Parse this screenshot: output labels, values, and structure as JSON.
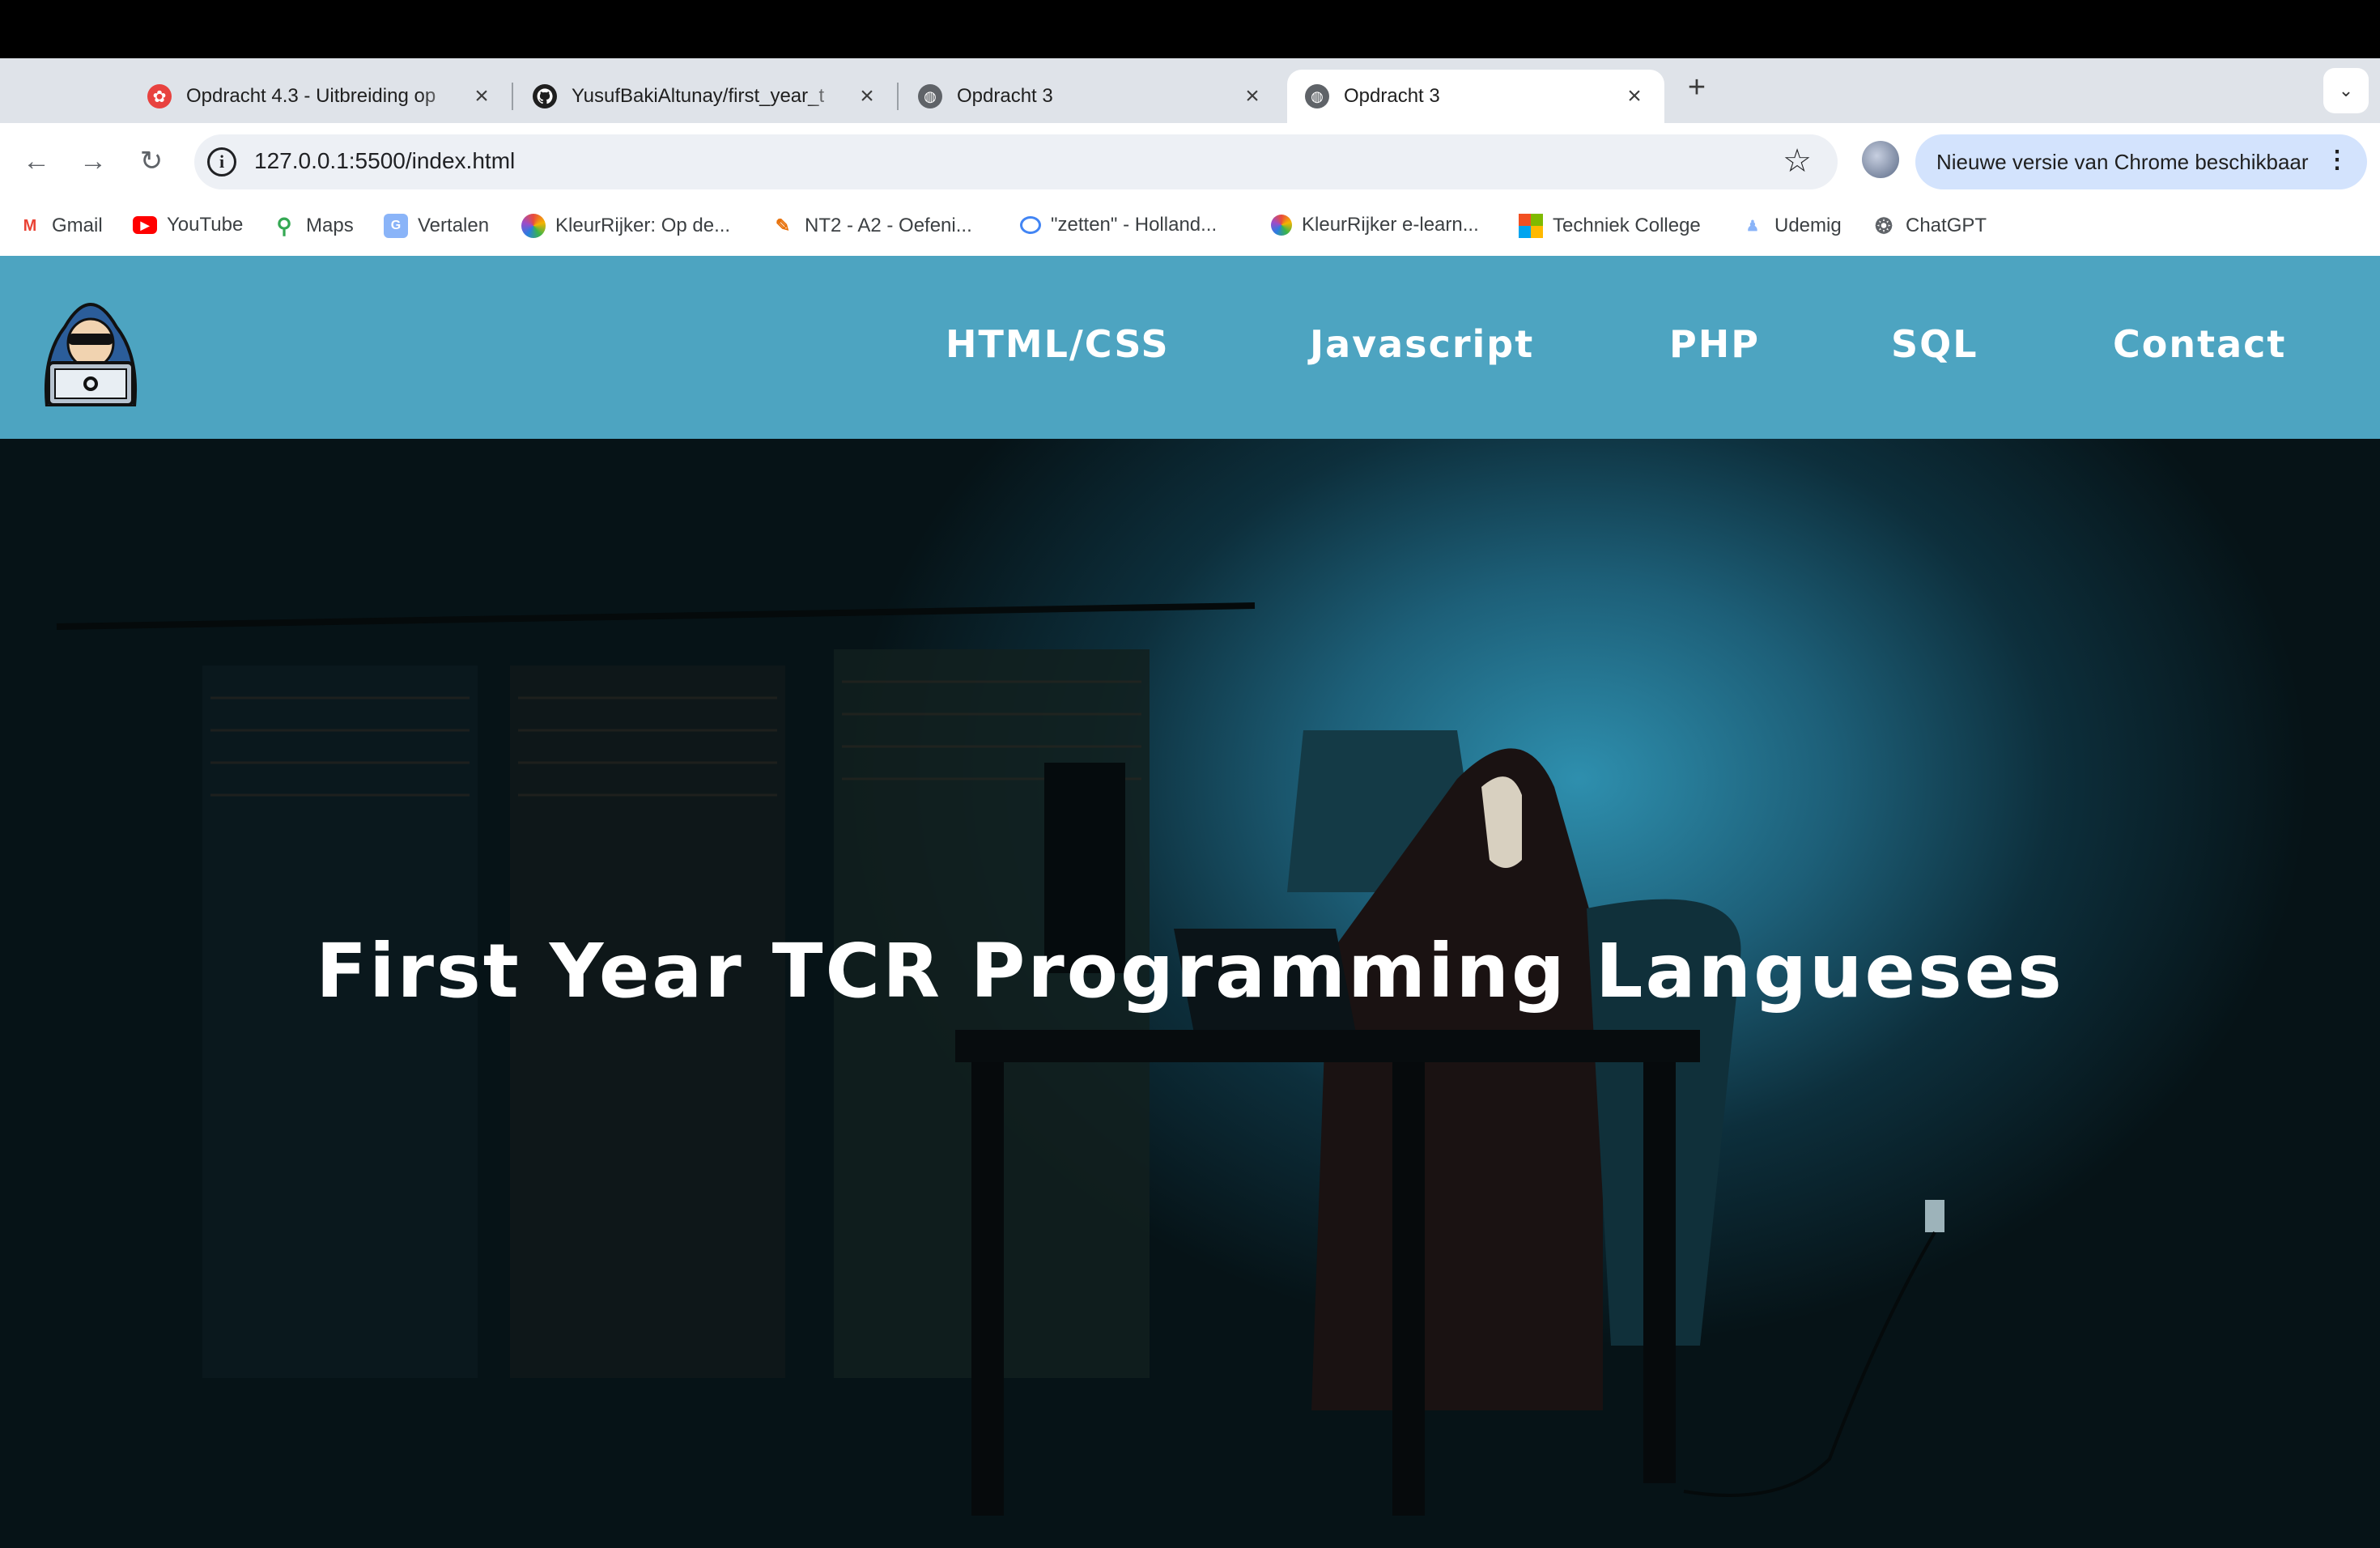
{
  "browser": {
    "tabs": [
      {
        "title": "Opdracht 4.3 - Uitbreiding op",
        "icon": "cog-icon",
        "active": false
      },
      {
        "title": "YusufBakiAltunay/first_year_t",
        "icon": "github-icon",
        "active": false
      },
      {
        "title": "Opdracht 3",
        "icon": "globe-icon",
        "active": false
      },
      {
        "title": "Opdracht 3",
        "icon": "globe-icon",
        "active": true
      }
    ],
    "close_glyph": "×",
    "new_tab_glyph": "+",
    "tab_search_glyph": "⌄",
    "address": "127.0.0.1:5500/index.html",
    "info_glyph": "i",
    "star_glyph": "☆",
    "update_label": "Nieuwe versie van Chrome beschikbaar",
    "menu_glyph": "⋮",
    "back_glyph": "←",
    "forward_glyph": "→",
    "reload_glyph": "↻",
    "bookmarks": [
      {
        "label": "Gmail",
        "icon": "gmail-icon"
      },
      {
        "label": "YouTube",
        "icon": "youtube-icon"
      },
      {
        "label": "Maps",
        "icon": "maps-icon"
      },
      {
        "label": "Vertalen",
        "icon": "translate-icon"
      },
      {
        "label": "KleurRijker: Op de...",
        "icon": "kleurrijker-icon"
      },
      {
        "label": "NT2 - A2 - Oefeni...",
        "icon": "nt2-icon"
      },
      {
        "label": "\"zetten\" - Holland...",
        "icon": "chat-bubble-icon"
      },
      {
        "label": "KleurRijker e-learn...",
        "icon": "kleurrijker-icon"
      },
      {
        "label": "Techniek College",
        "icon": "microsoft-icon"
      },
      {
        "label": "Udemig",
        "icon": "udemig-icon"
      },
      {
        "label": "ChatGPT",
        "icon": "chatgpt-icon"
      }
    ]
  },
  "site": {
    "header_color": "#4da4c1",
    "logo_icon": "hacker-logo-icon",
    "nav": [
      "HTML/CSS",
      "Javascript",
      "PHP",
      "SQL",
      "Contact"
    ],
    "hero_title": "First Year TCR Programming Langueses"
  }
}
